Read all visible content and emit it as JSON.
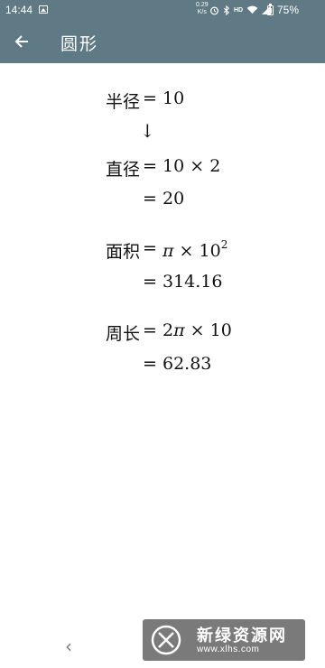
{
  "status_bar": {
    "time": "14:44",
    "net_speed_value": "0.29",
    "net_speed_unit": "K/s",
    "hd_label": "HD",
    "battery": "75%"
  },
  "app_bar": {
    "back_icon": "arrow-left-icon",
    "title": "圆形"
  },
  "content": {
    "radius": {
      "label": "半径",
      "eq": "=",
      "value": "10"
    },
    "arrow": "↓",
    "diameter": {
      "label": "直径",
      "eq": "=",
      "expr_a": "10",
      "times": "×",
      "expr_b": "2",
      "result_eq": "=",
      "result": "20"
    },
    "area": {
      "label": "面积",
      "eq": "=",
      "pi": "π",
      "times": "×",
      "base": "10",
      "exponent": "2",
      "result_eq": "=",
      "result": "314.16"
    },
    "perimeter": {
      "label": "周长",
      "eq": "=",
      "coef": "2",
      "pi": "π",
      "times": "×",
      "value": "10",
      "result_eq": "=",
      "result": "62.83"
    }
  },
  "bottom": {
    "nav_back": "‹",
    "watermark_name": "新绿资源网",
    "watermark_url": "www.xlhs.com"
  },
  "colors": {
    "app_bar": "#5f7a85",
    "text": "#111111",
    "watermark_bg": "#464646"
  }
}
